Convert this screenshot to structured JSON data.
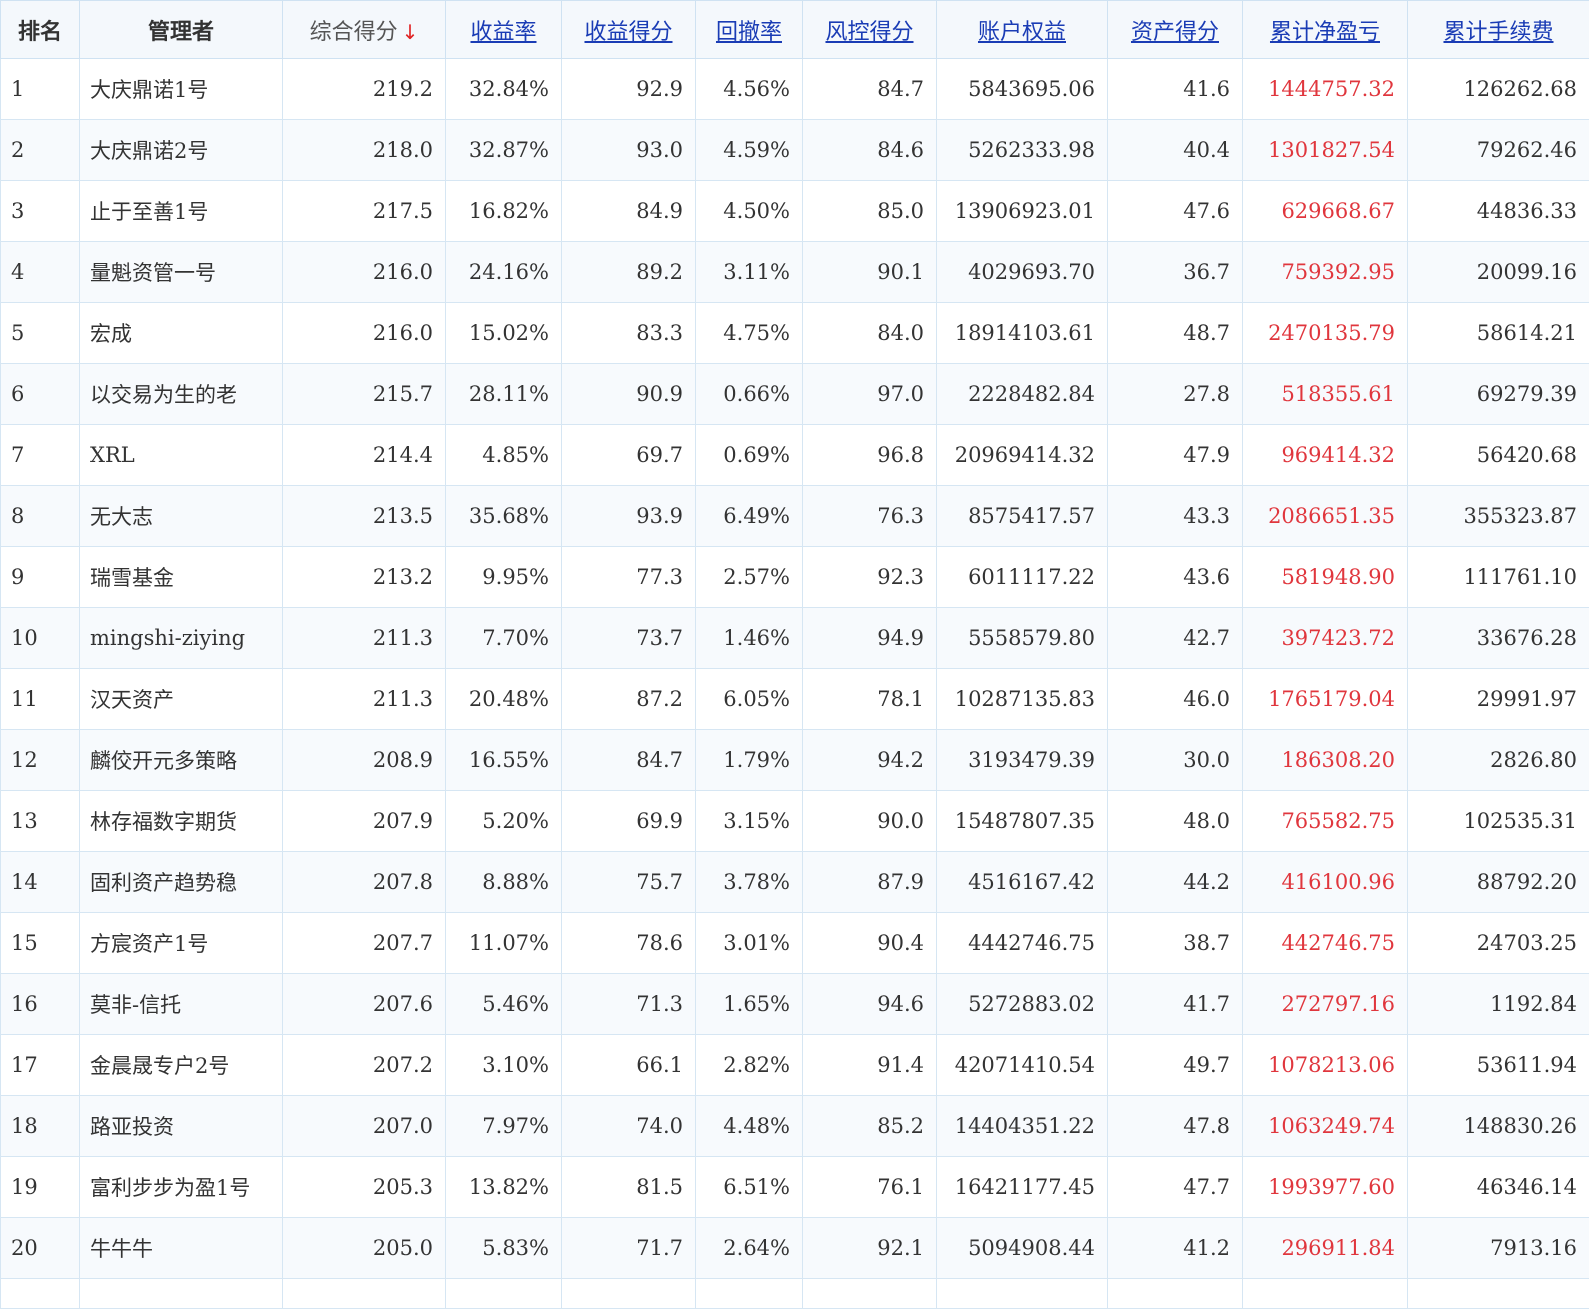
{
  "table": {
    "headers": [
      {
        "key": "rank",
        "label": "排名",
        "sortable": false
      },
      {
        "key": "manager",
        "label": "管理者",
        "sortable": false
      },
      {
        "key": "total_score",
        "label": "综合得分",
        "sortable": true,
        "active": true,
        "arrow": "↓"
      },
      {
        "key": "return_rate",
        "label": "收益率",
        "sortable": true
      },
      {
        "key": "return_score",
        "label": "收益得分",
        "sortable": true
      },
      {
        "key": "drawdown",
        "label": "回撤率",
        "sortable": true
      },
      {
        "key": "risk_score",
        "label": "风控得分",
        "sortable": true
      },
      {
        "key": "equity",
        "label": "账户权益",
        "sortable": true
      },
      {
        "key": "asset_score",
        "label": "资产得分",
        "sortable": true
      },
      {
        "key": "net_pnl",
        "label": "累计净盈亏",
        "sortable": true
      },
      {
        "key": "fees",
        "label": "累计手续费",
        "sortable": true
      }
    ],
    "rows": [
      [
        "1",
        "大庆鼎诺1号",
        "219.2",
        "32.84%",
        "92.9",
        "4.56%",
        "84.7",
        "5843695.06",
        "41.6",
        "1444757.32",
        "126262.68"
      ],
      [
        "2",
        "大庆鼎诺2号",
        "218.0",
        "32.87%",
        "93.0",
        "4.59%",
        "84.6",
        "5262333.98",
        "40.4",
        "1301827.54",
        "79262.46"
      ],
      [
        "3",
        "止于至善1号",
        "217.5",
        "16.82%",
        "84.9",
        "4.50%",
        "85.0",
        "13906923.01",
        "47.6",
        "629668.67",
        "44836.33"
      ],
      [
        "4",
        "量魁资管一号",
        "216.0",
        "24.16%",
        "89.2",
        "3.11%",
        "90.1",
        "4029693.70",
        "36.7",
        "759392.95",
        "20099.16"
      ],
      [
        "5",
        "宏成",
        "216.0",
        "15.02%",
        "83.3",
        "4.75%",
        "84.0",
        "18914103.61",
        "48.7",
        "2470135.79",
        "58614.21"
      ],
      [
        "6",
        "以交易为生的老",
        "215.7",
        "28.11%",
        "90.9",
        "0.66%",
        "97.0",
        "2228482.84",
        "27.8",
        "518355.61",
        "69279.39"
      ],
      [
        "7",
        "XRL",
        "214.4",
        "4.85%",
        "69.7",
        "0.69%",
        "96.8",
        "20969414.32",
        "47.9",
        "969414.32",
        "56420.68"
      ],
      [
        "8",
        "无大志",
        "213.5",
        "35.68%",
        "93.9",
        "6.49%",
        "76.3",
        "8575417.57",
        "43.3",
        "2086651.35",
        "355323.87"
      ],
      [
        "9",
        "瑞雪基金",
        "213.2",
        "9.95%",
        "77.3",
        "2.57%",
        "92.3",
        "6011117.22",
        "43.6",
        "581948.90",
        "111761.10"
      ],
      [
        "10",
        "mingshi-ziying",
        "211.3",
        "7.70%",
        "73.7",
        "1.46%",
        "94.9",
        "5558579.80",
        "42.7",
        "397423.72",
        "33676.28"
      ],
      [
        "11",
        "汉天资产",
        "211.3",
        "20.48%",
        "87.2",
        "6.05%",
        "78.1",
        "10287135.83",
        "46.0",
        "1765179.04",
        "29991.97"
      ],
      [
        "12",
        "麟佼开元多策略",
        "208.9",
        "16.55%",
        "84.7",
        "1.79%",
        "94.2",
        "3193479.39",
        "30.0",
        "186308.20",
        "2826.80"
      ],
      [
        "13",
        "林存福数字期货",
        "207.9",
        "5.20%",
        "69.9",
        "3.15%",
        "90.0",
        "15487807.35",
        "48.0",
        "765582.75",
        "102535.31"
      ],
      [
        "14",
        "固利资产趋势稳",
        "207.8",
        "8.88%",
        "75.7",
        "3.78%",
        "87.9",
        "4516167.42",
        "44.2",
        "416100.96",
        "88792.20"
      ],
      [
        "15",
        "方宸资产1号",
        "207.7",
        "11.07%",
        "78.6",
        "3.01%",
        "90.4",
        "4442746.75",
        "38.7",
        "442746.75",
        "24703.25"
      ],
      [
        "16",
        "莫非-信托",
        "207.6",
        "5.46%",
        "71.3",
        "1.65%",
        "94.6",
        "5272883.02",
        "41.7",
        "272797.16",
        "1192.84"
      ],
      [
        "17",
        "金晨晟专户2号",
        "207.2",
        "3.10%",
        "66.1",
        "2.82%",
        "91.4",
        "42071410.54",
        "49.7",
        "1078213.06",
        "53611.94"
      ],
      [
        "18",
        "路亚投资",
        "207.0",
        "7.97%",
        "74.0",
        "4.48%",
        "85.2",
        "14404351.22",
        "47.8",
        "1063249.74",
        "148830.26"
      ],
      [
        "19",
        "富利步步为盈1号",
        "205.3",
        "13.82%",
        "81.5",
        "6.51%",
        "76.1",
        "16421177.45",
        "47.7",
        "1993977.60",
        "46346.14"
      ],
      [
        "20",
        "牛牛牛",
        "205.0",
        "5.83%",
        "71.7",
        "2.64%",
        "92.1",
        "5094908.44",
        "41.2",
        "296911.84",
        "7913.16"
      ]
    ]
  },
  "colors": {
    "link": "#1a3cb5",
    "sort_arrow": "#e02424",
    "profit_text": "#e0363d",
    "border": "#d6e6f3",
    "header_bg": "#f4f8fc"
  }
}
